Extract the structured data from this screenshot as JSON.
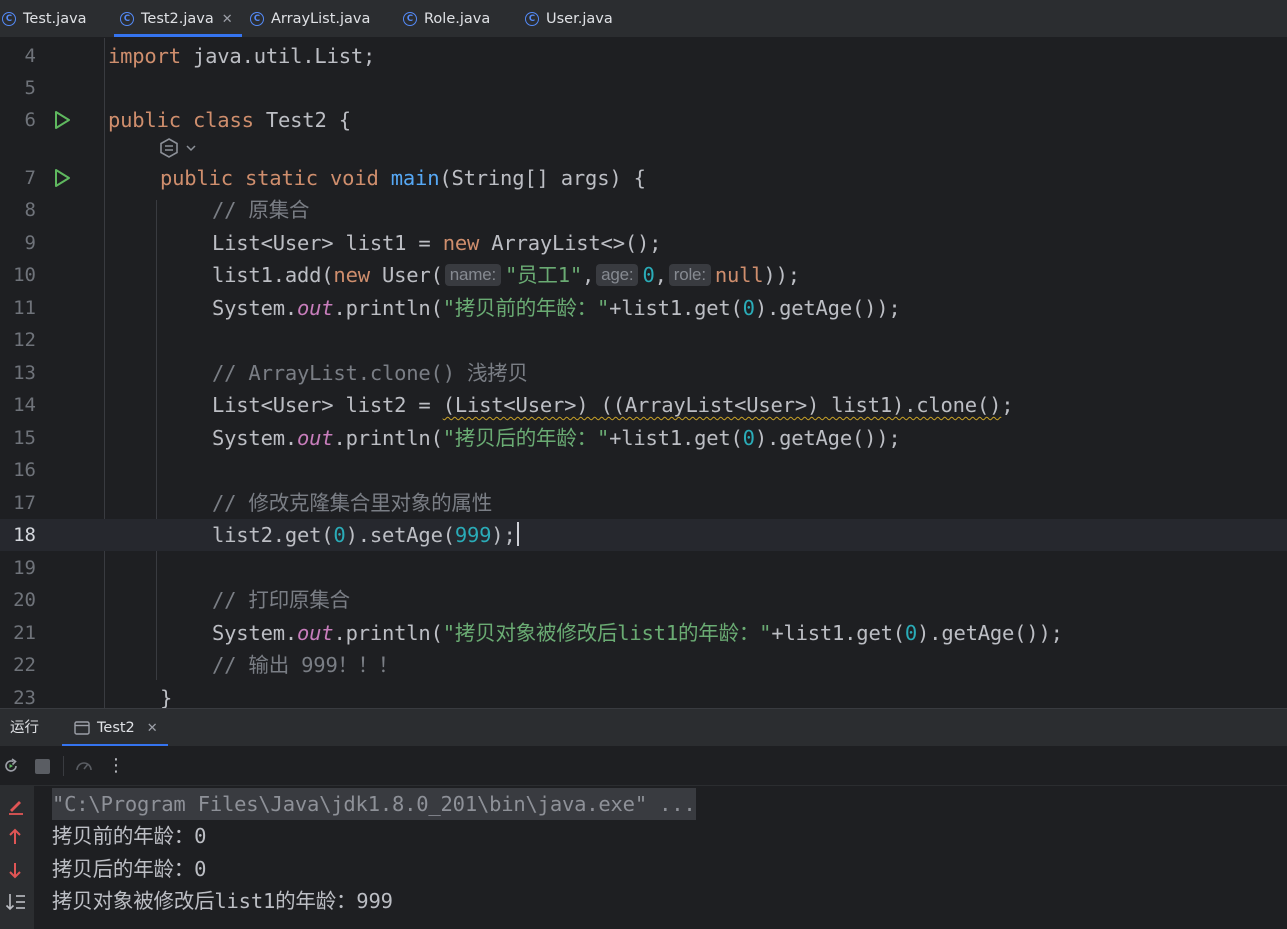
{
  "tabs": [
    {
      "label": "Test.java",
      "active": false
    },
    {
      "label": "Test2.java",
      "active": true
    },
    {
      "label": "ArrayList.java",
      "active": false
    },
    {
      "label": "Role.java",
      "active": false
    },
    {
      "label": "User.java",
      "active": false
    }
  ],
  "editor": {
    "current_line": "18",
    "lines": [
      {
        "no": "4"
      },
      {
        "no": "5"
      },
      {
        "no": "6"
      },
      {
        "no": "7"
      },
      {
        "no": "8"
      },
      {
        "no": "9"
      },
      {
        "no": "10"
      },
      {
        "no": "11"
      },
      {
        "no": "12"
      },
      {
        "no": "13"
      },
      {
        "no": "14"
      },
      {
        "no": "15"
      },
      {
        "no": "16"
      },
      {
        "no": "17"
      },
      {
        "no": "18"
      },
      {
        "no": "19"
      },
      {
        "no": "20"
      },
      {
        "no": "21"
      },
      {
        "no": "22"
      },
      {
        "no": "23"
      }
    ],
    "code": {
      "l4_kw": "import",
      "l4_rest": " java.util.List;",
      "l6_kw1": "public",
      "l6_kw2": "class",
      "l6_rest": " Test2 {",
      "l7_kw1": "public",
      "l7_kw2": "static",
      "l7_kw3": "void",
      "l7_fn": "main",
      "l7_rest": "(String[] args) {",
      "l8_comment": "// 原集合",
      "l9_a": "List<User> list1 = ",
      "l9_kw": "new",
      "l9_b": " ArrayList<>();",
      "l10_a": "list1.add(",
      "l10_kw": "new",
      "l10_b": " User(",
      "l10_hint1": "name:",
      "l10_str": "\"员工1\"",
      "l10_comma1": ",",
      "l10_hint2": "age:",
      "l10_num": "0",
      "l10_comma2": ",",
      "l10_hint3": "role:",
      "l10_kw2": "null",
      "l10_c": "));",
      "l11_a": "System.",
      "l11_fld": "out",
      "l11_b": ".println(",
      "l11_str": "\"拷贝前的年龄：\"",
      "l11_c": "+list1.get(",
      "l11_num": "0",
      "l11_d": ").getAge());",
      "l13_comment": "// ArrayList.clone() 浅拷贝",
      "l14_a": "List<User> list2 = ",
      "l14_warn": "(List<User>) ((ArrayList<User>) list1).clone()",
      "l14_b": ";",
      "l15_a": "System.",
      "l15_fld": "out",
      "l15_b": ".println(",
      "l15_str": "\"拷贝后的年龄：\"",
      "l15_c": "+list1.get(",
      "l15_num": "0",
      "l15_d": ").getAge());",
      "l17_comment": "// 修改克隆集合里对象的属性",
      "l18_a": "list2.get(",
      "l18_num1": "0",
      "l18_b": ").setAge(",
      "l18_num2": "999",
      "l18_c": ");",
      "l20_comment": "// 打印原集合",
      "l21_a": "System.",
      "l21_fld": "out",
      "l21_b": ".println(",
      "l21_str": "\"拷贝对象被修改后list1的年龄：\"",
      "l21_c": "+list1.get(",
      "l21_num": "0",
      "l21_d": ").getAge());",
      "l22_comment": "// 输出 999！！！",
      "l23": "}"
    }
  },
  "run_panel": {
    "title": "运行",
    "tab_label": "Test2"
  },
  "console": {
    "lines": [
      "\"C:\\Program Files\\Java\\jdk1.8.0_201\\bin\\java.exe\" ...",
      "拷贝前的年龄：0",
      "拷贝后的年龄：0",
      "拷贝对象被修改后list1的年龄：999"
    ]
  },
  "colors": {
    "background": "#1e1f22",
    "keyword": "#cf8e6d",
    "string": "#6aab73",
    "number": "#2aacb8",
    "comment": "#7a7e85",
    "function": "#56a8f5",
    "field": "#c77dbb",
    "accent": "#3574f0"
  },
  "icons": {
    "tab_file": "java-class-icon",
    "gutter_run": "run-gutter-icon",
    "rerun": "rerun-icon",
    "stop": "stop-icon",
    "more": "more-icon"
  }
}
